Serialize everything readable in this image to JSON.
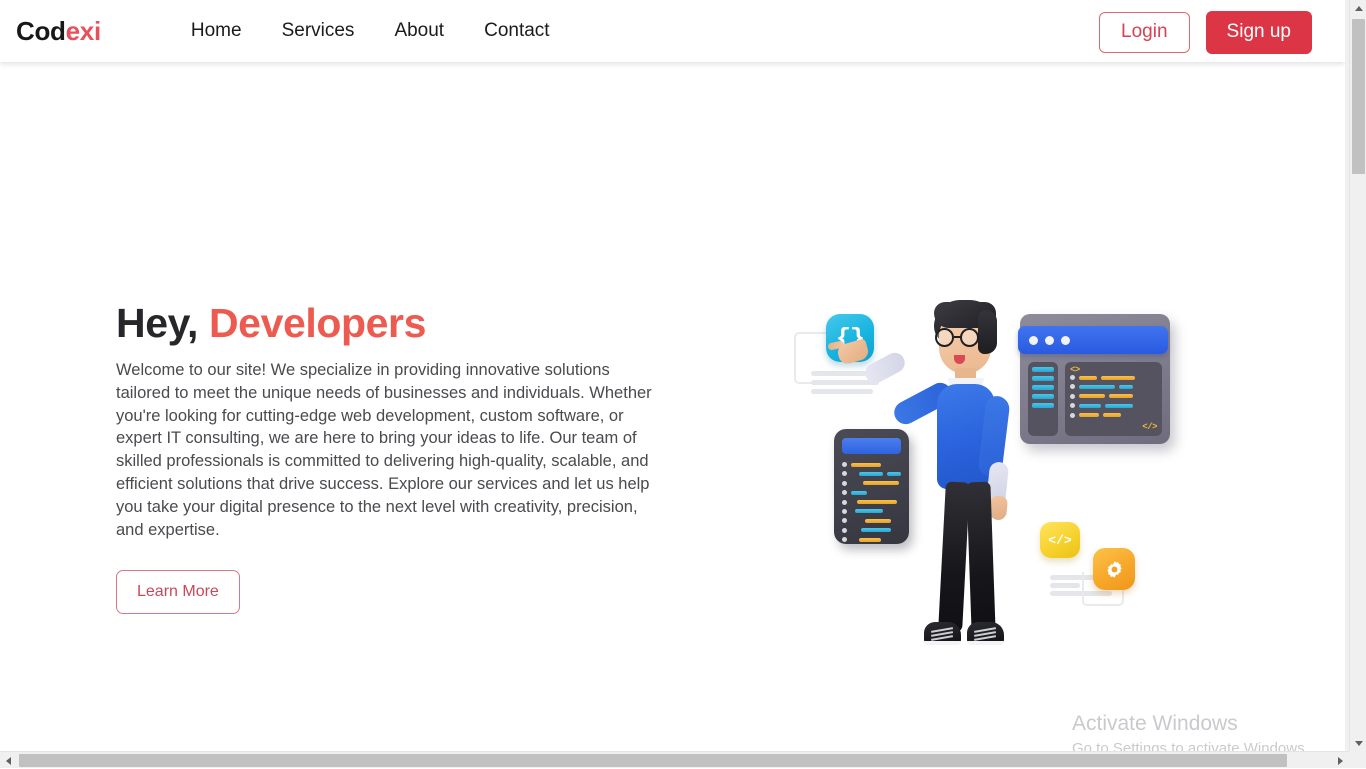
{
  "header": {
    "logo": {
      "part1": "Cod",
      "part2": "exi"
    },
    "nav": [
      {
        "label": "Home"
      },
      {
        "label": "Services"
      },
      {
        "label": "About"
      },
      {
        "label": "Contact"
      }
    ],
    "login_label": "Login",
    "signup_label": "Sign up"
  },
  "hero": {
    "title_plain": "Hey, ",
    "title_accent": "Developers",
    "paragraph": "Welcome to our site! We specialize in providing innovative solutions tailored to meet the unique needs of businesses and individuals. Whether you're looking for cutting-edge web development, custom software, or expert IT consulting, we are here to bring your ideas to life. Our team of skilled professionals is committed to delivering high-quality, scalable, and efficient solutions that drive success. Explore our services and let us help you take your digital presence to the next level with creativity, precision, and expertise.",
    "cta_label": "Learn More"
  },
  "illustration": {
    "brace_glyph": "{}",
    "code_glyph": "</>",
    "window_tag_open": "<>",
    "window_tag_close": "</>",
    "alt": "3d-developer-character-illustration"
  },
  "watermark": {
    "title": "Activate Windows",
    "subtitle": "Go to Settings to activate Windows."
  },
  "colors": {
    "accent_red": "#dc3545",
    "title_accent": "#ed5a50",
    "logo_accent": "#e8505b",
    "shirt_blue": "#2a63dd",
    "icon_cyan": "#18b4e0",
    "icon_yellow": "#f7d22e",
    "icon_orange": "#f7a82a",
    "code_orange": "#e9a424",
    "code_cyan": "#24a9d4"
  }
}
